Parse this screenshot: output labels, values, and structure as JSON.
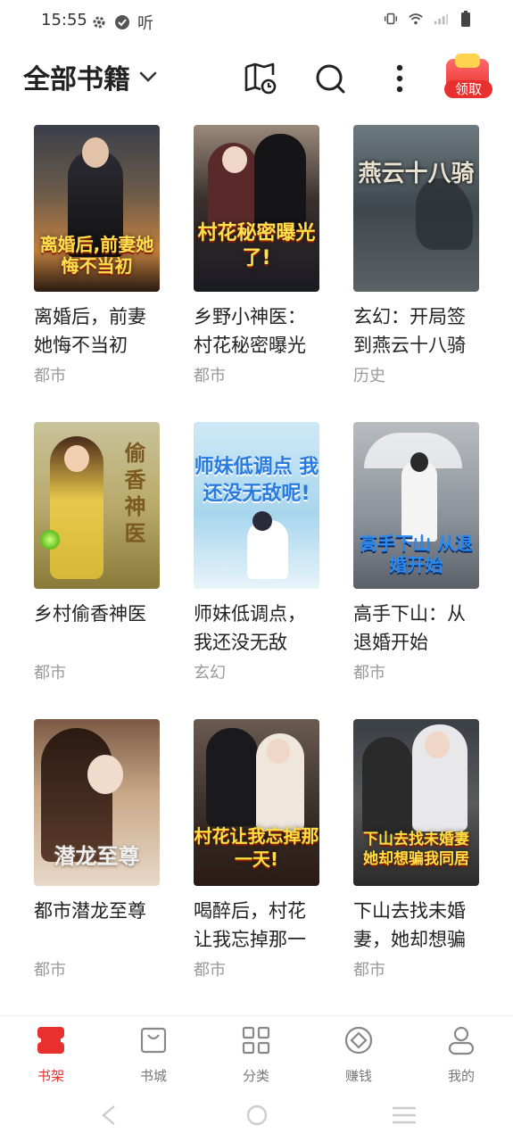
{
  "status_bar": {
    "time": "15:55",
    "listen_label": "听",
    "icons": [
      "settings-icon",
      "check-circle-icon",
      "vibrate-icon",
      "wifi-icon",
      "signal-icon",
      "battery-icon"
    ]
  },
  "header": {
    "title": "全部书籍",
    "reward_label": "领取",
    "icons": [
      "book-clock-icon",
      "search-icon",
      "more-vertical-icon",
      "gift-icon"
    ]
  },
  "books": [
    {
      "title": "离婚后，前妻她悔不当初",
      "genre": "都市",
      "cover_text": "离婚后,前妻她悔不当初"
    },
    {
      "title": "乡野小神医：村花秘密曝光",
      "genre": "都市",
      "cover_text": "村花秘密曝光了!"
    },
    {
      "title": "玄幻：开局签到燕云十八骑",
      "genre": "历史",
      "cover_text": "燕云十八骑"
    },
    {
      "title": "乡村偷香神医",
      "genre": "都市",
      "cover_text": "偷香神医"
    },
    {
      "title": "师妹低调点，我还没无敌",
      "genre": "玄幻",
      "cover_text": "师妹低调点 我还没无敌呢!"
    },
    {
      "title": "高手下山：从退婚开始",
      "genre": "都市",
      "cover_text": "高手下山 从退婚开始"
    },
    {
      "title": "都市潜龙至尊",
      "genre": "都市",
      "cover_text": "潜龙至尊"
    },
    {
      "title": "喝醉后，村花让我忘掉那一",
      "genre": "都市",
      "cover_text": "村花让我忘掉那一天!"
    },
    {
      "title": "下山去找未婚妻，她却想骗",
      "genre": "都市",
      "cover_text": "下山去找未婚妻 她却想骗我同居"
    }
  ],
  "bottom_nav": [
    {
      "label": "书架",
      "icon": "bookshelf-icon",
      "active": true
    },
    {
      "label": "书城",
      "icon": "shopping-bag-icon",
      "active": false
    },
    {
      "label": "分类",
      "icon": "grid-icon",
      "active": false
    },
    {
      "label": "赚钱",
      "icon": "coin-icon",
      "active": false
    },
    {
      "label": "我的",
      "icon": "user-icon",
      "active": false
    }
  ],
  "colors": {
    "accent": "#e8302f",
    "genre_text": "#999999",
    "nav_inactive": "#777777"
  }
}
